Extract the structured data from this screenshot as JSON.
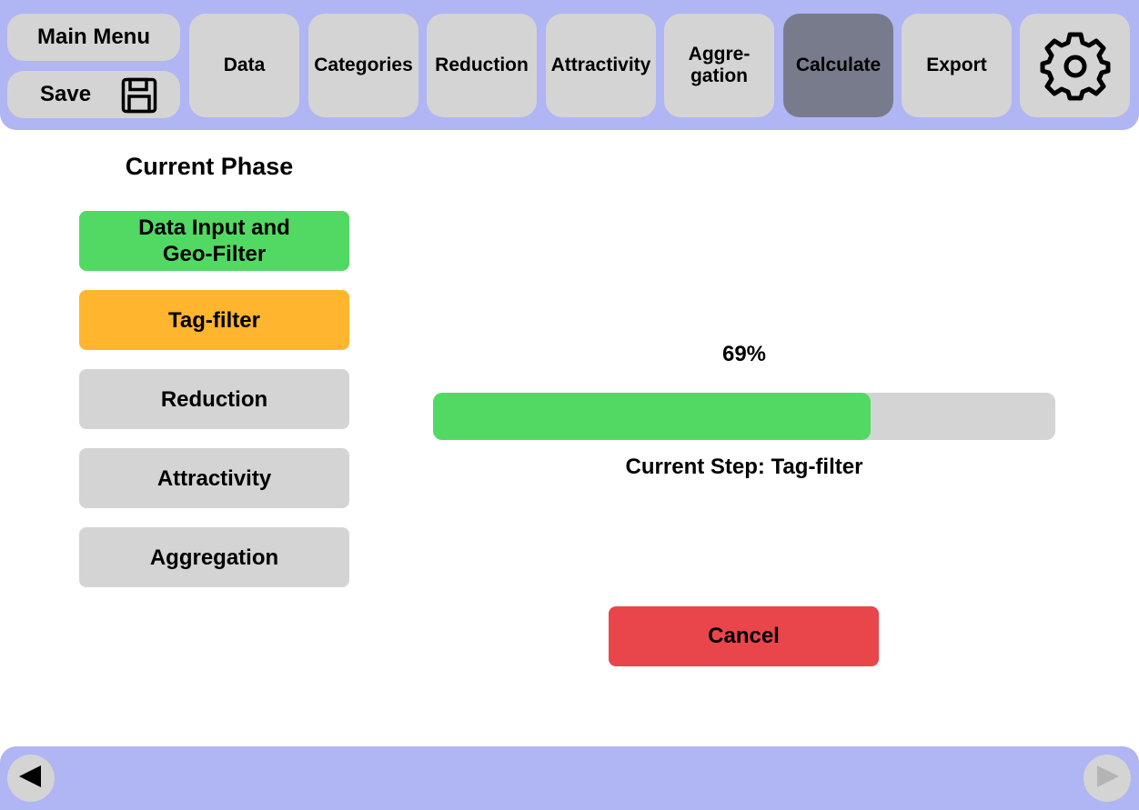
{
  "toolbar": {
    "main_menu_label": "Main Menu",
    "save_label": "Save",
    "save_icon": "floppy-disk-icon",
    "settings_icon": "gear-icon",
    "tabs": [
      {
        "label": "Data",
        "active": false
      },
      {
        "label": "Categories",
        "active": false
      },
      {
        "label": "Reduction",
        "active": false
      },
      {
        "label": "Attractivity",
        "active": false
      },
      {
        "label": "Aggre-\ngation",
        "active": false
      },
      {
        "label": "Calculate",
        "active": true
      },
      {
        "label": "Export",
        "active": false
      }
    ]
  },
  "phases": {
    "title": "Current Phase",
    "items": [
      {
        "label": "Data Input and Geo-Filter",
        "status": "done"
      },
      {
        "label": "Tag-filter",
        "status": "current"
      },
      {
        "label": "Reduction",
        "status": "pending"
      },
      {
        "label": "Attractivity",
        "status": "pending"
      },
      {
        "label": "Aggregation",
        "status": "pending"
      }
    ]
  },
  "progress": {
    "percent_label": "69%",
    "value": 0.703,
    "step_text": "Current Step: Tag-filter"
  },
  "actions": {
    "cancel_label": "Cancel"
  },
  "footer": {
    "back_icon": "triangle-left-icon",
    "forward_icon": "triangle-right-icon"
  },
  "colors": {
    "bar_background": "#b0b5f3",
    "button_gray": "#d4d4d4",
    "active_tab": "#787b8b",
    "done_green": "#52d963",
    "current_orange": "#ffb52e",
    "cancel_red": "#e8464b"
  }
}
